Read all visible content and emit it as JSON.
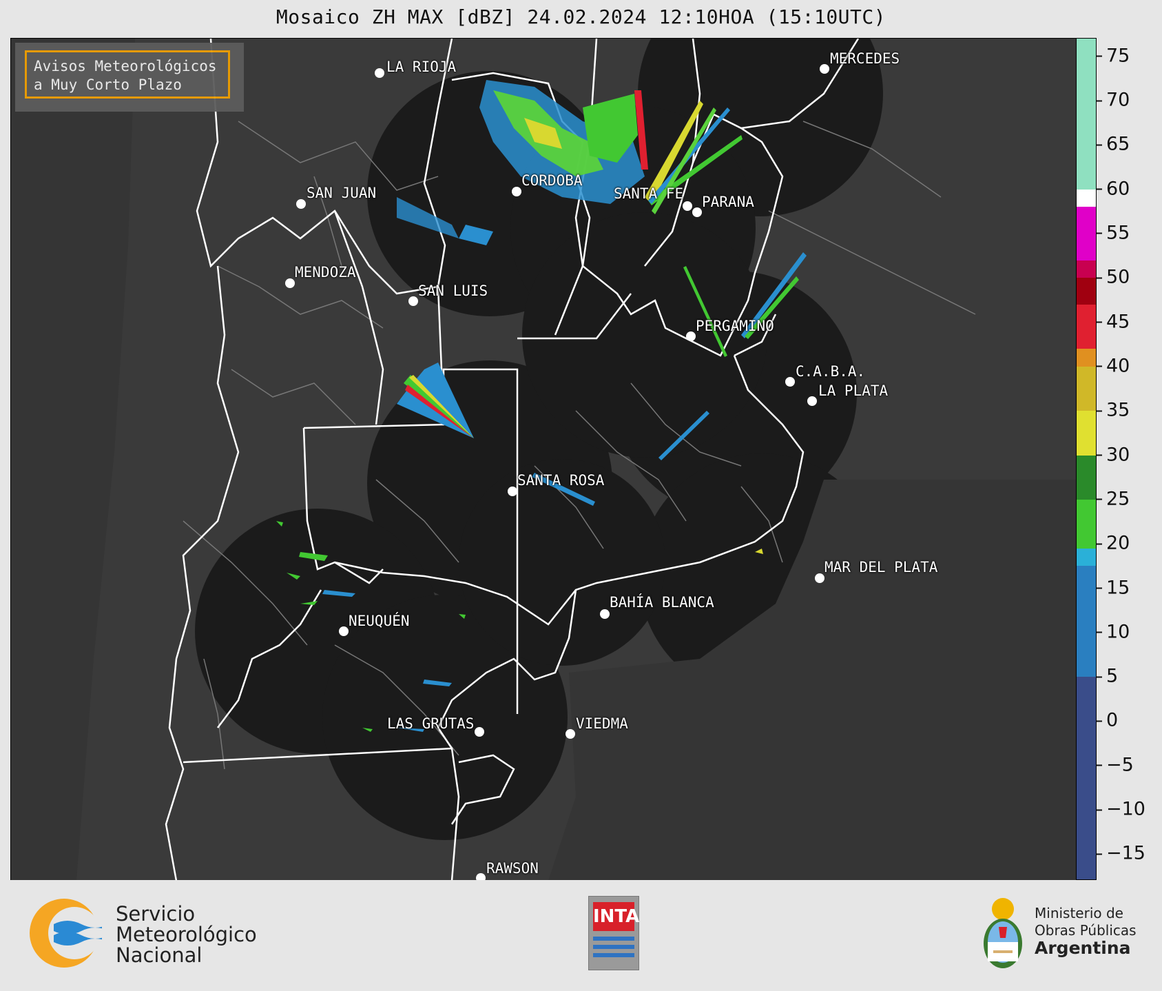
{
  "title": "Mosaico ZH MAX [dBZ] 24.02.2024 12:10HOA (15:10UTC)",
  "alert": {
    "line1": "Avisos Meteorológicos",
    "line2": "a Muy Corto Plazo"
  },
  "cities": [
    {
      "name": "LA RIOJA"
    },
    {
      "name": "MERCEDES"
    },
    {
      "name": "CORDOBA"
    },
    {
      "name": "SAN JUAN"
    },
    {
      "name": "SANTA FE"
    },
    {
      "name": "PARANA"
    },
    {
      "name": "MENDOZA"
    },
    {
      "name": "SAN LUIS"
    },
    {
      "name": "PERGAMINO"
    },
    {
      "name": "C.A.B.A."
    },
    {
      "name": "LA PLATA"
    },
    {
      "name": "SANTA ROSA"
    },
    {
      "name": "MAR DEL PLATA"
    },
    {
      "name": "BAHÍA BLANCA"
    },
    {
      "name": "NEUQUÉN"
    },
    {
      "name": "LAS GRUTAS"
    },
    {
      "name": "VIEDMA"
    },
    {
      "name": "RAWSON"
    }
  ],
  "colorbar": {
    "unit": "dBZ",
    "min": -18,
    "max": 77,
    "ticks": [
      "75",
      "70",
      "65",
      "60",
      "55",
      "50",
      "45",
      "40",
      "35",
      "30",
      "25",
      "20",
      "15",
      "10",
      "5",
      "0",
      "−5",
      "−10",
      "−15"
    ],
    "tick_values": [
      75,
      70,
      65,
      60,
      55,
      50,
      45,
      40,
      35,
      30,
      25,
      20,
      15,
      10,
      5,
      0,
      -5,
      -10,
      -15
    ],
    "bands": [
      {
        "from": -18,
        "to": 5,
        "color": "#3a4d8a"
      },
      {
        "from": 5,
        "to": 17.5,
        "color": "#2a7fc0"
      },
      {
        "from": 17.5,
        "to": 19.5,
        "color": "#2ab0d8"
      },
      {
        "from": 19.5,
        "to": 25,
        "color": "#42c832"
      },
      {
        "from": 25,
        "to": 30,
        "color": "#2a8a2a"
      },
      {
        "from": 30,
        "to": 35,
        "color": "#e0e030"
      },
      {
        "from": 35,
        "to": 40,
        "color": "#d0b828"
      },
      {
        "from": 40,
        "to": 42,
        "color": "#e09020"
      },
      {
        "from": 42,
        "to": 47,
        "color": "#e02030"
      },
      {
        "from": 47,
        "to": 50,
        "color": "#a00010"
      },
      {
        "from": 50,
        "to": 52,
        "color": "#c80050"
      },
      {
        "from": 52,
        "to": 58,
        "color": "#e000c8"
      },
      {
        "from": 58,
        "to": 60,
        "color": "#ffffff"
      },
      {
        "from": 60,
        "to": 77,
        "color": "#8fe0c0"
      }
    ]
  },
  "footer": {
    "smn_line1": "Servicio",
    "smn_line2": "Meteorológico",
    "smn_line3": "Nacional",
    "inta": "INTA",
    "ministry_line1": "Ministerio de",
    "ministry_line2": "Obras Públicas",
    "ministry_country": "Argentina"
  },
  "colors": {
    "radar_disc": "#1b1b1b",
    "land": "#3a3a3a",
    "province_border": "#ffffff",
    "alert_border": "#f0a000"
  }
}
